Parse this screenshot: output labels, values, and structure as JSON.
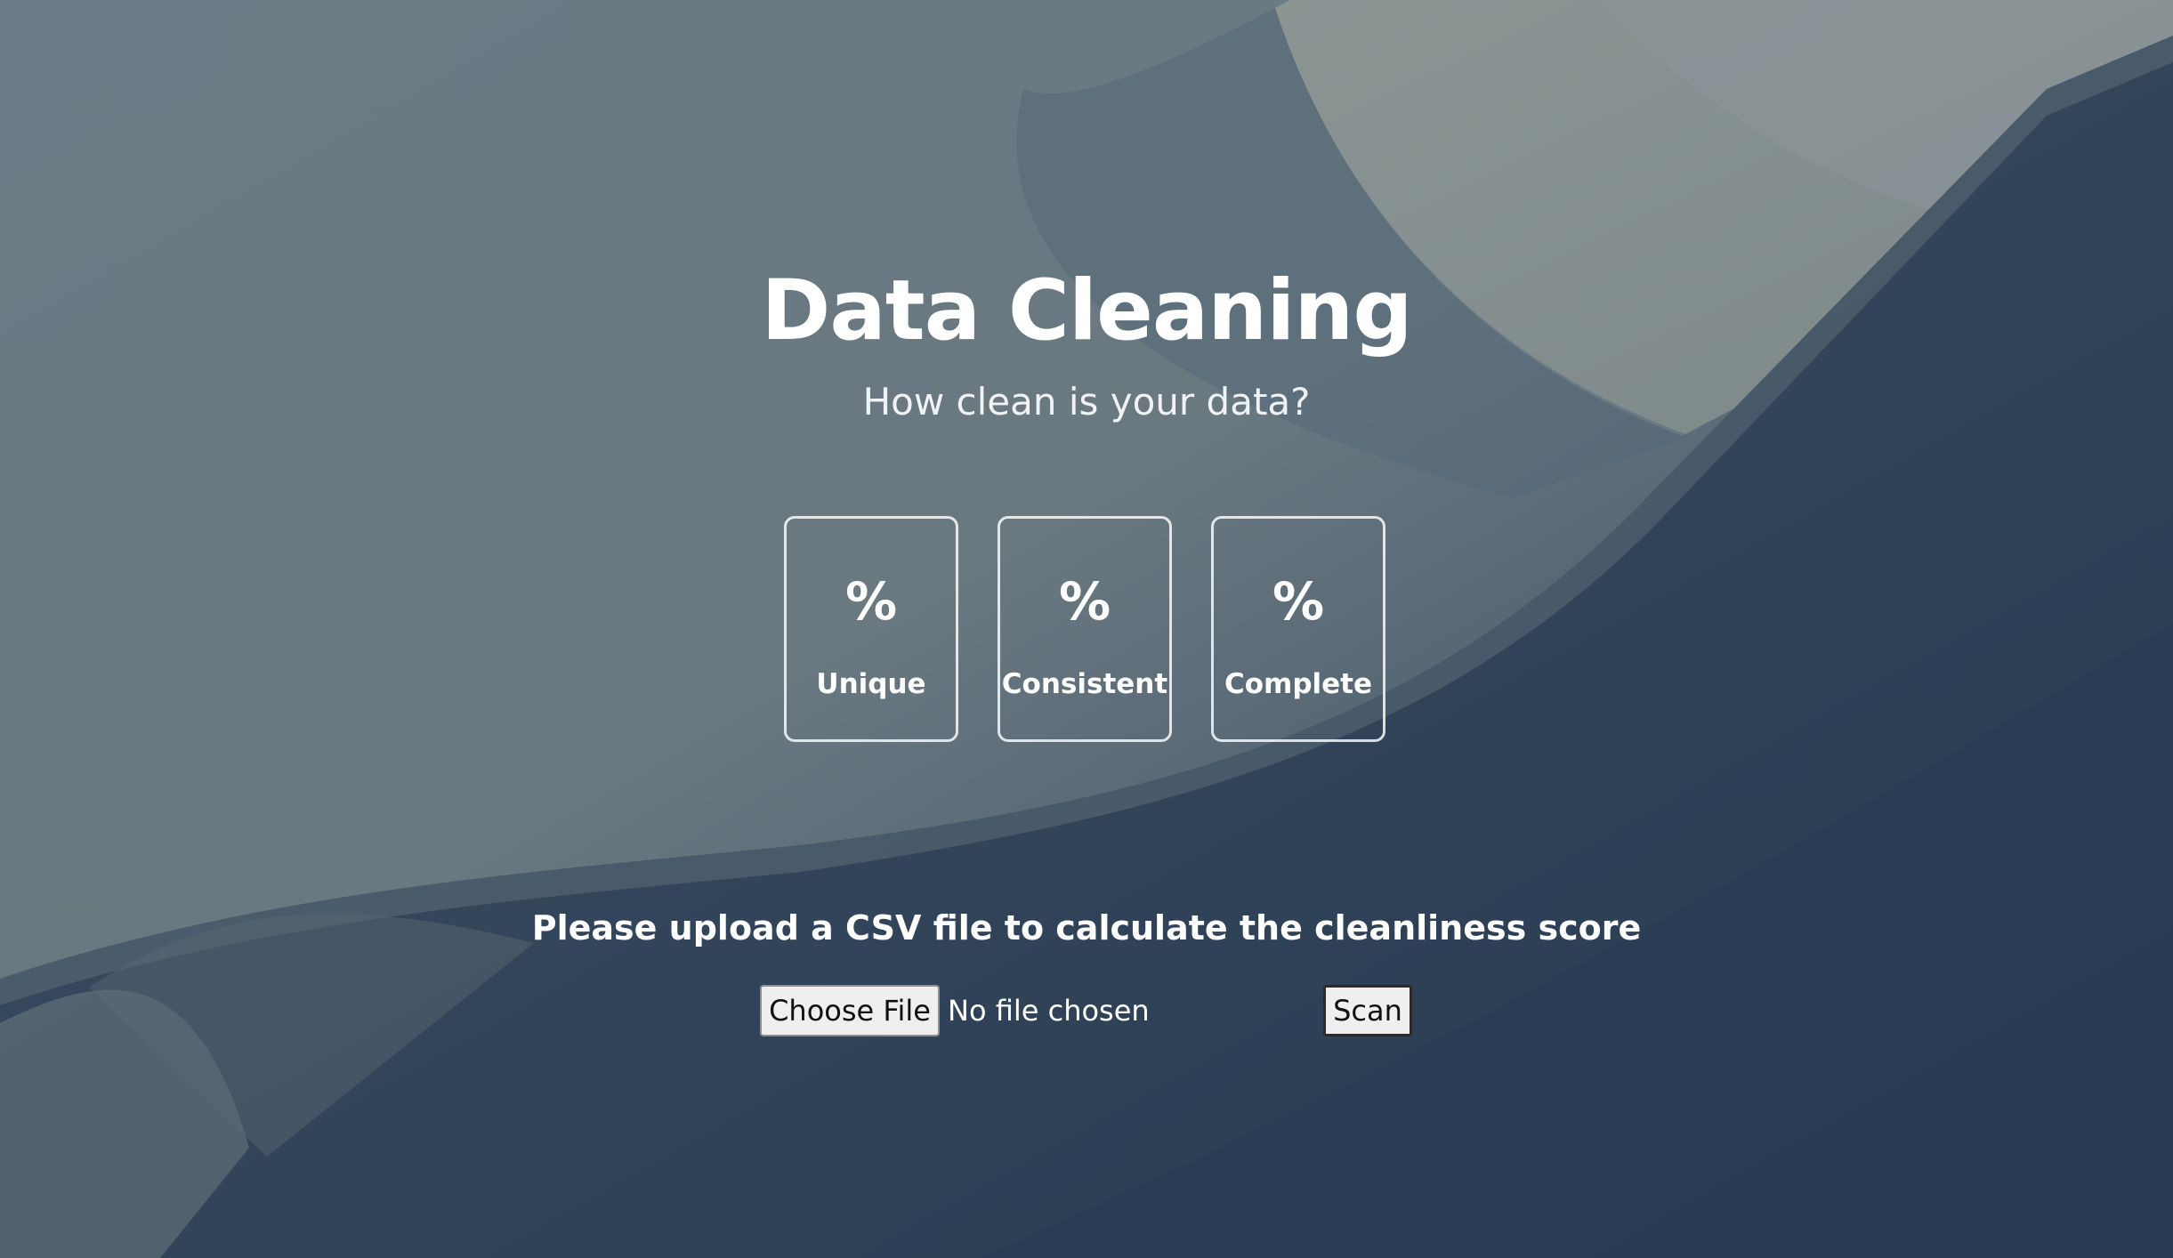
{
  "header": {
    "title": "Data Cleaning",
    "subtitle": "How clean is your data?"
  },
  "metrics": [
    {
      "value": "%",
      "label": "Unique"
    },
    {
      "value": "%",
      "label": "Consistent"
    },
    {
      "value": "%",
      "label": "Complete"
    }
  ],
  "upload": {
    "prompt": "Please upload a CSV file to calculate the cleanliness score",
    "choose_label": "Choose File",
    "file_status": "No file chosen",
    "scan_label": "Scan"
  }
}
